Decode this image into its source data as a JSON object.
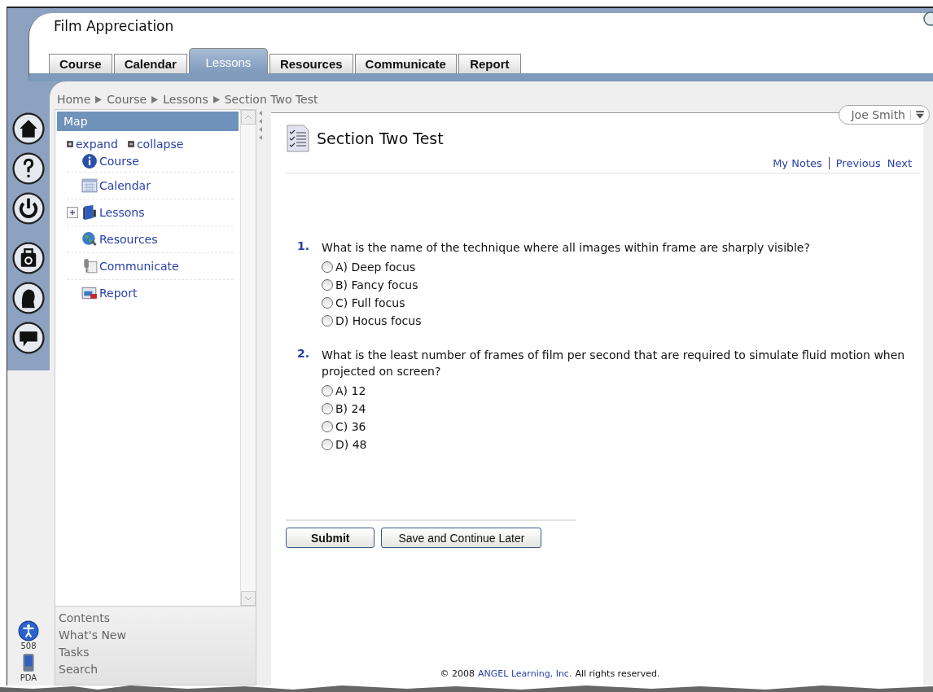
{
  "window": {
    "title": "Film Appreciation"
  },
  "tabs": [
    {
      "label": "Course",
      "selected": false
    },
    {
      "label": "Calendar",
      "selected": false
    },
    {
      "label": "Lessons",
      "selected": true
    },
    {
      "label": "Resources",
      "selected": false
    },
    {
      "label": "Communicate",
      "selected": false
    },
    {
      "label": "Report",
      "selected": false
    }
  ],
  "toolbar": [
    {
      "kind": "home"
    },
    {
      "kind": "help"
    },
    {
      "kind": "power"
    },
    {
      "kind": "briefcase"
    },
    {
      "kind": "profile"
    },
    {
      "kind": "chat"
    }
  ],
  "side_tools": [
    {
      "label": "508",
      "kind": "accessibility"
    },
    {
      "label": "PDA",
      "kind": "pda"
    }
  ],
  "breadcrumb": [
    "Home",
    "Course",
    "Lessons",
    "Section Two Test"
  ],
  "user_menu": {
    "name": "Joe Smith"
  },
  "map": {
    "title": "Map",
    "expand": "expand",
    "collapse": "collapse",
    "items": [
      {
        "label": "Course",
        "kind": "info",
        "expandable": false
      },
      {
        "label": "Calendar",
        "kind": "calendar",
        "expandable": false
      },
      {
        "label": "Lessons",
        "kind": "lessons",
        "expandable": true
      },
      {
        "label": "Resources",
        "kind": "globe",
        "expandable": false
      },
      {
        "label": "Communicate",
        "kind": "mic",
        "expandable": false
      },
      {
        "label": "Report",
        "kind": "report",
        "expandable": false
      }
    ]
  },
  "bottom_links": [
    "Contents",
    "What's New",
    "Tasks",
    "Search"
  ],
  "page": {
    "title": "Section Two Test",
    "links": [
      "My Notes",
      "Previous",
      "Next"
    ],
    "questions": [
      {
        "number": "1.",
        "text": "What is the name of the technique where all images within frame are sharply visible?",
        "options": [
          {
            "label": "A) Deep focus",
            "selected": false
          },
          {
            "label": "B) Fancy focus",
            "selected": false
          },
          {
            "label": "C) Full focus",
            "selected": false
          },
          {
            "label": "D) Hocus focus",
            "selected": false
          }
        ]
      },
      {
        "number": "2.",
        "text": "What is the least number of frames of film per second that are required to simulate fluid motion when projected on screen?",
        "options": [
          {
            "label": "A) 12",
            "selected": false
          },
          {
            "label": "B) 24",
            "selected": false
          },
          {
            "label": "C) 36",
            "selected": false
          },
          {
            "label": "D) 48",
            "selected": false
          }
        ]
      }
    ],
    "buttons": [
      {
        "label": "Submit",
        "primary": true
      },
      {
        "label": "Save and Continue Later",
        "primary": false
      }
    ]
  },
  "footer": {
    "prefix": "© 2008",
    "link": "ANGEL Learning, Inc.",
    "suffix": "All rights reserved."
  }
}
